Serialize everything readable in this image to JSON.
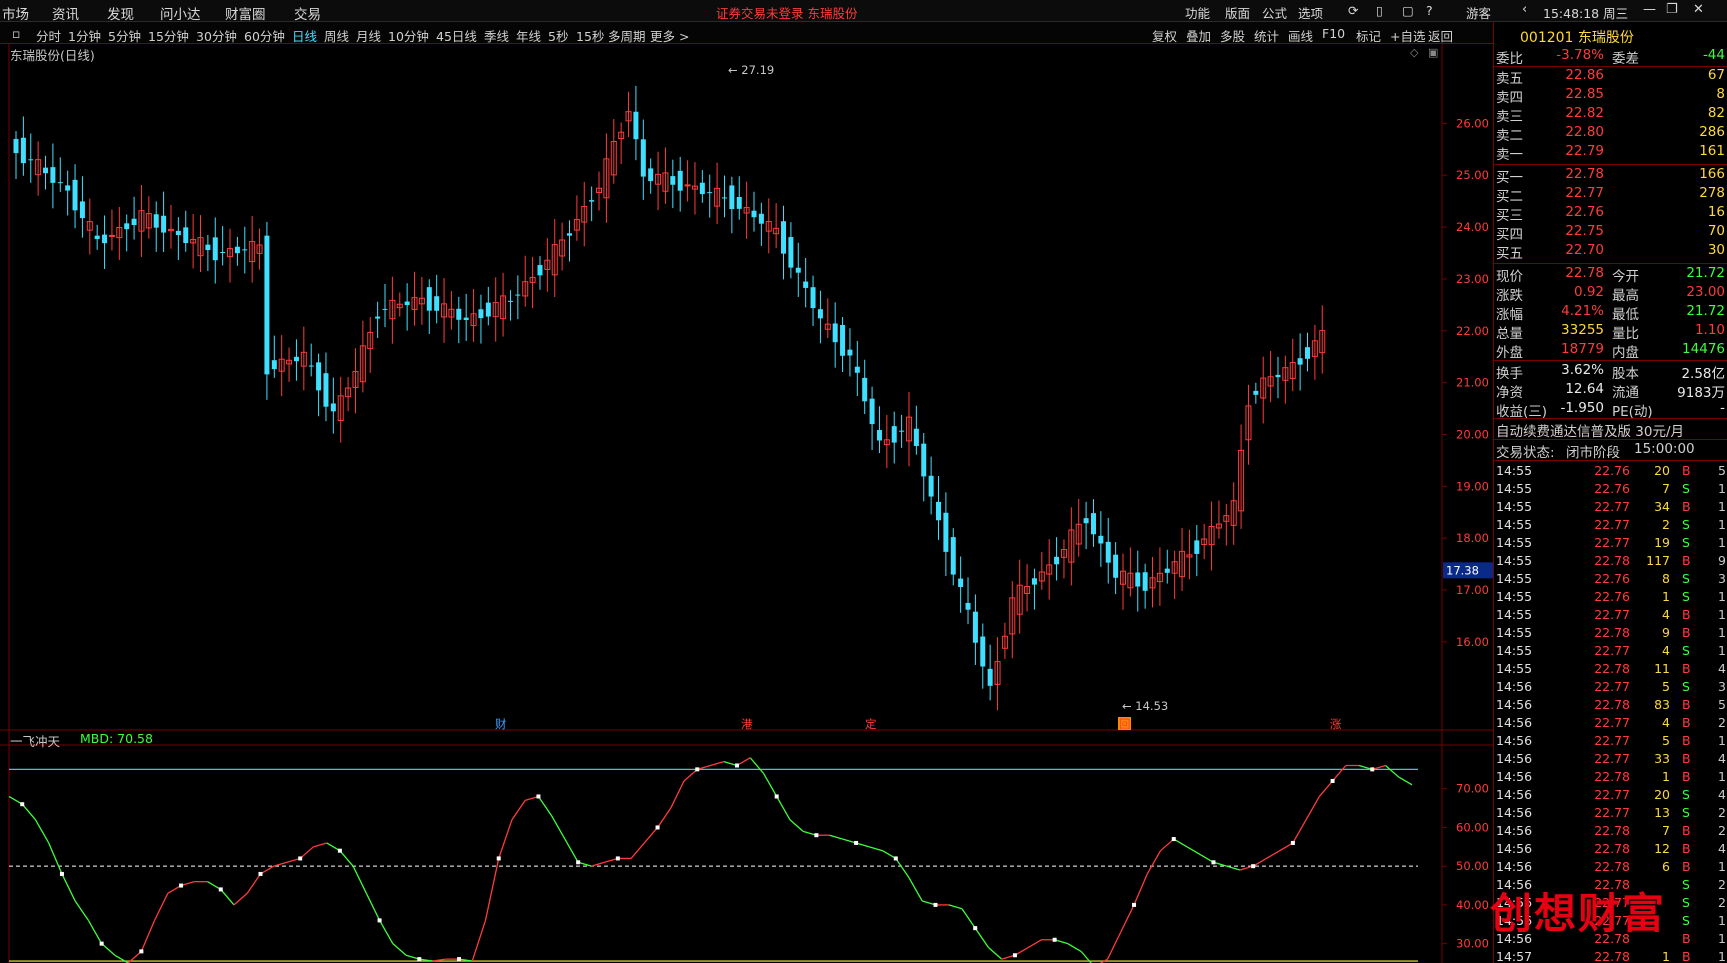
{
  "menu": [
    "市场",
    "资讯",
    "发现",
    "问小达",
    "财富圈",
    "交易"
  ],
  "notice": "证券交易未登录  东瑞股份",
  "tools": [
    "功能",
    "版面",
    "公式",
    "选项"
  ],
  "user": "游客",
  "clock": "15:48:18 周三",
  "periods": [
    "分时",
    "1分钟",
    "5分钟",
    "15分钟",
    "30分钟",
    "60分钟",
    "日线",
    "周线",
    "月线",
    "10分钟",
    "45日线",
    "季线",
    "年线",
    "5秒",
    "15秒",
    "多周期",
    "更多 >"
  ],
  "selected_period": "日线",
  "right_tools": [
    "复权",
    "叠加",
    "多股",
    "统计",
    "画线",
    "F10",
    "标记",
    "+自选",
    "返回"
  ],
  "chart_title": "东瑞股份(日线)",
  "indicator": {
    "name": "一飞冲天",
    "value_label": "MBD: 70.58"
  },
  "stock": {
    "code": "001201",
    "name": "东瑞股份"
  },
  "weibi": {
    "label": "委比",
    "value": "-3.78%",
    "label2": "委差",
    "value2": "-44"
  },
  "asks": [
    {
      "label": "卖五",
      "price": "22.86",
      "vol": "67"
    },
    {
      "label": "卖四",
      "price": "22.85",
      "vol": "8"
    },
    {
      "label": "卖三",
      "price": "22.82",
      "vol": "82"
    },
    {
      "label": "卖二",
      "price": "22.80",
      "vol": "286"
    },
    {
      "label": "卖一",
      "price": "22.79",
      "vol": "161"
    }
  ],
  "bids": [
    {
      "label": "买一",
      "price": "22.78",
      "vol": "166"
    },
    {
      "label": "买二",
      "price": "22.77",
      "vol": "278"
    },
    {
      "label": "买三",
      "price": "22.76",
      "vol": "16"
    },
    {
      "label": "买四",
      "price": "22.75",
      "vol": "70"
    },
    {
      "label": "买五",
      "price": "22.70",
      "vol": "30"
    }
  ],
  "quote": [
    {
      "l1": "现价",
      "v1": "22.78",
      "c1": "red",
      "l2": "今开",
      "v2": "21.72",
      "c2": "green"
    },
    {
      "l1": "涨跌",
      "v1": "0.92",
      "c1": "red",
      "l2": "最高",
      "v2": "23.00",
      "c2": "red"
    },
    {
      "l1": "涨幅",
      "v1": "4.21%",
      "c1": "red",
      "l2": "最低",
      "v2": "21.72",
      "c2": "green"
    },
    {
      "l1": "总量",
      "v1": "33255",
      "c1": "yellow",
      "l2": "量比",
      "v2": "1.10",
      "c2": "red"
    },
    {
      "l1": "外盘",
      "v1": "18779",
      "c1": "red",
      "l2": "内盘",
      "v2": "14476",
      "c2": "green"
    }
  ],
  "quote2": [
    {
      "l1": "换手",
      "v1": "3.62%",
      "l2": "股本",
      "v2": "2.58亿"
    },
    {
      "l1": "净资",
      "v1": "12.64",
      "l2": "流通",
      "v2": "9183万"
    },
    {
      "l1": "收益(三)",
      "v1": "-1.950",
      "l2": "PE(动)",
      "v2": "-"
    }
  ],
  "promo": "自动续费通达信普及版  30元/月",
  "trade_status": {
    "label": "交易状态:",
    "value": "闭市阶段",
    "time": "15:00:00"
  },
  "trades": [
    [
      "14:55",
      "22.76",
      "20",
      "B",
      "5"
    ],
    [
      "14:55",
      "22.76",
      "7",
      "S",
      "1"
    ],
    [
      "14:55",
      "22.77",
      "34",
      "B",
      "1"
    ],
    [
      "14:55",
      "22.77",
      "2",
      "S",
      "1"
    ],
    [
      "14:55",
      "22.77",
      "19",
      "S",
      "1"
    ],
    [
      "14:55",
      "22.78",
      "117",
      "B",
      "9"
    ],
    [
      "14:55",
      "22.76",
      "8",
      "S",
      "3"
    ],
    [
      "14:55",
      "22.76",
      "1",
      "S",
      "1"
    ],
    [
      "14:55",
      "22.77",
      "4",
      "B",
      "1"
    ],
    [
      "14:55",
      "22.78",
      "9",
      "B",
      "1"
    ],
    [
      "14:55",
      "22.77",
      "4",
      "S",
      "1"
    ],
    [
      "14:55",
      "22.78",
      "11",
      "B",
      "4"
    ],
    [
      "14:56",
      "22.77",
      "5",
      "S",
      "3"
    ],
    [
      "14:56",
      "22.78",
      "83",
      "B",
      "5"
    ],
    [
      "14:56",
      "22.77",
      "4",
      "B",
      "2"
    ],
    [
      "14:56",
      "22.77",
      "5",
      "B",
      "1"
    ],
    [
      "14:56",
      "22.77",
      "33",
      "B",
      "4"
    ],
    [
      "14:56",
      "22.78",
      "1",
      "B",
      "1"
    ],
    [
      "14:56",
      "22.77",
      "20",
      "S",
      "4"
    ],
    [
      "14:56",
      "22.77",
      "13",
      "S",
      "2"
    ],
    [
      "14:56",
      "22.78",
      "7",
      "B",
      "2"
    ],
    [
      "14:56",
      "22.78",
      "12",
      "B",
      "4"
    ],
    [
      "14:56",
      "22.78",
      "6",
      "B",
      "1"
    ],
    [
      "14:56",
      "22.78",
      "",
      "S",
      "2"
    ],
    [
      "14:56",
      "22.77",
      "",
      "S",
      "2"
    ],
    [
      "14:56",
      "22.77",
      "",
      "S",
      "1"
    ],
    [
      "14:56",
      "22.78",
      "",
      "B",
      "1"
    ],
    [
      "14:57",
      "22.78",
      "1",
      "B",
      "1"
    ]
  ],
  "watermark": "创想财富",
  "chart_data": {
    "type": "candlestick",
    "y_ticks": [
      "26.00",
      "25.00",
      "24.00",
      "23.00",
      "22.00",
      "21.00",
      "20.00",
      "19.00",
      "18.00",
      "17.00",
      "16.00"
    ],
    "ylim": [
      14.3,
      27.3
    ],
    "current_price_tag": "17.38",
    "high_label": "27.19",
    "low_label": "14.53",
    "event_markers": [
      "财",
      "港",
      "定",
      "回",
      "涨"
    ],
    "indicator_ticks": [
      "70.00",
      "60.00",
      "50.00",
      "40.00",
      "30.00"
    ],
    "indicator_ylim": [
      25,
      80
    ],
    "indicator_lines": {
      "cyan": 75,
      "white_dashed": 50,
      "yellow": 25.5
    },
    "indicator_series": [
      68,
      66,
      62,
      56,
      48,
      41,
      36,
      30,
      27,
      25,
      28,
      36,
      43,
      45,
      46,
      46,
      44,
      40,
      43,
      48,
      50,
      51,
      52,
      55,
      56,
      54,
      50,
      43,
      36,
      30,
      27,
      26,
      25.5,
      26,
      26,
      25.5,
      36,
      52,
      62,
      67,
      68,
      63,
      57,
      51,
      50,
      51,
      52,
      52,
      56,
      60,
      65,
      72,
      75,
      76,
      77,
      76,
      78,
      74,
      68,
      62,
      59,
      58,
      58,
      57,
      56,
      55,
      54,
      52,
      47,
      41,
      40,
      40,
      39,
      34,
      29,
      26,
      27,
      29,
      31,
      31,
      30,
      28,
      24,
      26,
      33,
      40,
      48,
      54,
      57,
      55,
      53,
      51,
      50,
      49,
      50,
      52,
      54,
      56,
      62,
      68,
      72,
      76,
      76,
      75,
      76,
      73,
      71
    ]
  }
}
